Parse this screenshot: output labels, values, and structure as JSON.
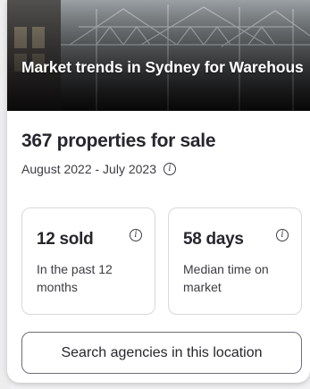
{
  "hero": {
    "title": "Market trends in Sydney for Warehouse, Factory & Industrial..."
  },
  "summary": {
    "properties_count": "367 properties for sale",
    "date_range": "August 2022 - July 2023",
    "info_icon": "info-circle-icon"
  },
  "stats": [
    {
      "value": "12 sold",
      "description": "In the past 12 months",
      "icon": "info-circle-icon"
    },
    {
      "value": "58 days",
      "description": "Median time on market",
      "icon": "info-circle-icon"
    }
  ],
  "search_button": {
    "label": "Search agencies in this location"
  },
  "colors": {
    "text_primary": "#26262c",
    "text_secondary": "#3c3c44",
    "card_border": "#d8d8dc",
    "button_border": "#6e6e78"
  }
}
